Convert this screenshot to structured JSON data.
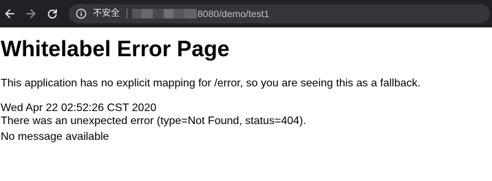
{
  "browser": {
    "security_label": "不安全",
    "url_visible": "8080/demo/test1",
    "colors": {
      "toolbar_bg": "#202124",
      "omnibox_bg": "#35363a",
      "icon_active": "#e8eaed",
      "icon_disabled": "#8e9196"
    },
    "icons": [
      "back-arrow-icon",
      "forward-arrow-icon",
      "reload-icon",
      "info-icon"
    ]
  },
  "page": {
    "title": "Whitelabel Error Page",
    "explanation": "This application has no explicit mapping for /error, so you are seeing this as a fallback.",
    "timestamp": "Wed Apr 22 02:52:26 CST 2020",
    "error_detail": "There was an unexpected error (type=Not Found, status=404).",
    "message": "No message available"
  }
}
